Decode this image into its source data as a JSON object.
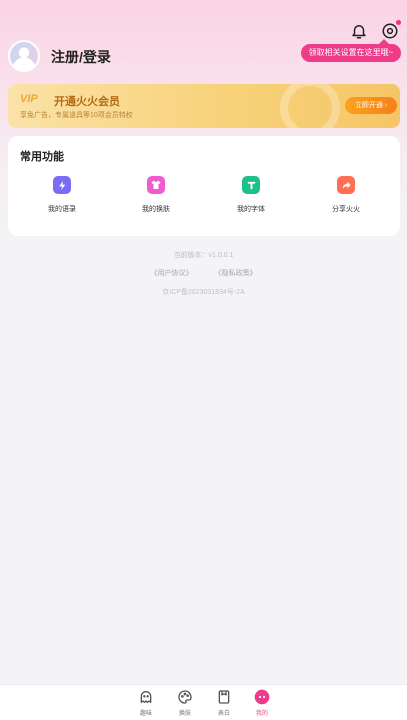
{
  "header": {
    "login_label": "注册/登录",
    "tooltip": "领取相关设置在这里哦~",
    "icons": [
      "bell-icon",
      "settings-icon"
    ]
  },
  "vip": {
    "badge": "VIP",
    "title": "开通火火会员",
    "subtitle": "享免广告，专属道具等10项会员特权",
    "button": "立即开通 ›"
  },
  "functions": {
    "title": "常用功能",
    "items": [
      {
        "label": "我的语录",
        "icon": "lightning-icon",
        "color": "#7b6cf6"
      },
      {
        "label": "我的换肤",
        "icon": "tshirt-icon",
        "color": "#f05bd0"
      },
      {
        "label": "我的字体",
        "icon": "text-icon",
        "color": "#20c08a"
      },
      {
        "label": "分享火火",
        "icon": "share-icon",
        "color": "#ff7052"
      }
    ]
  },
  "footer": {
    "version": "当前版本：v1.0.0.1",
    "user_agreement": "《用户协议》",
    "privacy_policy": "《隐私政策》",
    "icp": "京ICP备2023031834号-2A"
  },
  "tabbar": {
    "items": [
      {
        "label": "趣味",
        "icon": "ghost-icon",
        "active": false
      },
      {
        "label": "换肤",
        "icon": "palette-icon",
        "active": false
      },
      {
        "label": "表白",
        "icon": "card-icon",
        "active": false
      },
      {
        "label": "我的",
        "icon": "profile-icon",
        "active": true
      }
    ],
    "active_color": "#ee3c8b"
  }
}
